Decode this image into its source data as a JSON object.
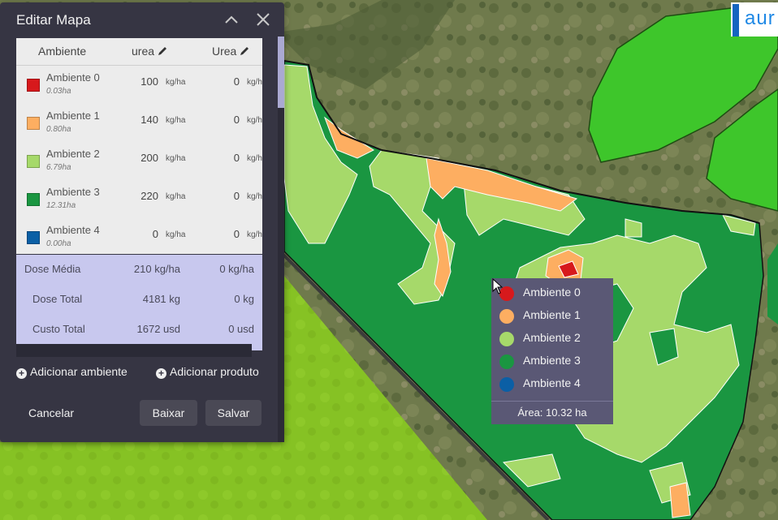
{
  "panel": {
    "title": "Editar Mapa",
    "columns": {
      "ambiente": "Ambiente",
      "product1": "urea",
      "product2": "Urea"
    },
    "rows": [
      {
        "name": "Ambiente 0",
        "area": "0.03ha",
        "color": "#d7191c",
        "v1": "100",
        "u1": "kg/ha",
        "v2": "0",
        "u2": "kg/ha"
      },
      {
        "name": "Ambiente 1",
        "area": "0.80ha",
        "color": "#fdae61",
        "v1": "140",
        "u1": "kg/ha",
        "v2": "0",
        "u2": "kg/ha"
      },
      {
        "name": "Ambiente 2",
        "area": "6.79ha",
        "color": "#a6d96a",
        "v1": "200",
        "u1": "kg/ha",
        "v2": "0",
        "u2": "kg/ha"
      },
      {
        "name": "Ambiente 3",
        "area": "12.31ha",
        "color": "#1a9641",
        "v1": "220",
        "u1": "kg/ha",
        "v2": "0",
        "u2": "kg/ha"
      },
      {
        "name": "Ambiente 4",
        "area": "0.00ha",
        "color": "#0b5fa5",
        "v1": "0",
        "u1": "kg/ha",
        "v2": "0",
        "u2": "kg/ha"
      }
    ],
    "summary": [
      {
        "label": "Dose Média",
        "v1": "210 kg/ha",
        "v2": "0 kg/ha"
      },
      {
        "label": "Dose Total",
        "v1": "4181 kg",
        "v2": "0 kg"
      },
      {
        "label": "Custo Total",
        "v1": "1672 usd",
        "v2": "0 usd"
      }
    ],
    "add_ambiente": "Adicionar ambiente",
    "add_produto": "Adicionar produto",
    "cancel": "Cancelar",
    "download": "Baixar",
    "save": "Salvar"
  },
  "legend": {
    "items": [
      {
        "label": "Ambiente 0",
        "color": "#d7191c"
      },
      {
        "label": "Ambiente 1",
        "color": "#fdae61"
      },
      {
        "label": "Ambiente 2",
        "color": "#a6d96a"
      },
      {
        "label": "Ambiente 3",
        "color": "#1a9641"
      },
      {
        "label": "Ambiente 4",
        "color": "#0b5fa5"
      }
    ],
    "area": "Área: 10.32 ha"
  },
  "logo": {
    "text": "aur"
  },
  "icons": {
    "collapse": "chevron-up-icon",
    "close": "close-icon",
    "edit": "pencil-icon",
    "add": "plus-circle-icon"
  },
  "colors": {
    "panel_bg": "#363543",
    "summary_bg": "#c8c8ee",
    "legend_bg": "#5a5875"
  }
}
